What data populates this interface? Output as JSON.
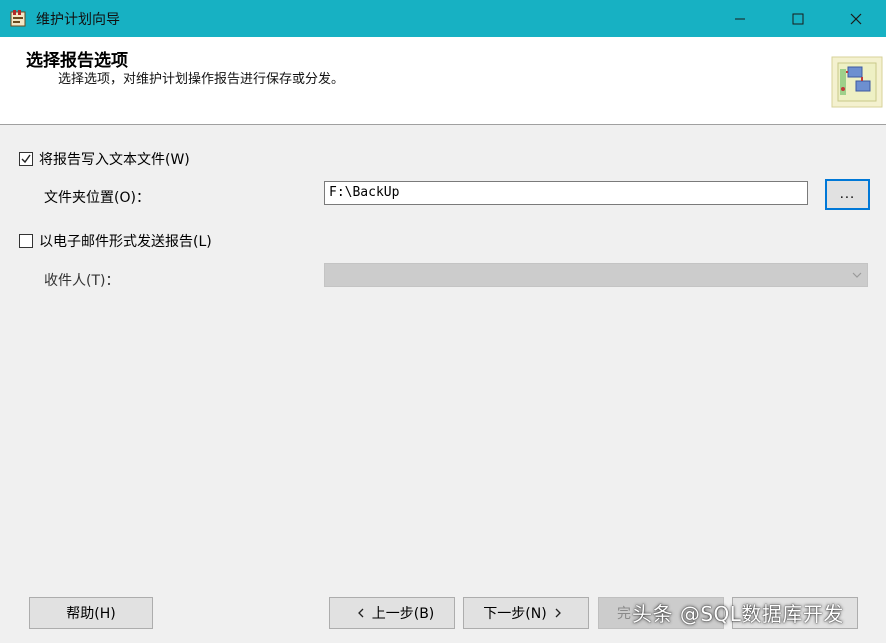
{
  "window": {
    "title": "维护计划向导",
    "accent_color": "#17b1c3"
  },
  "header": {
    "title": "选择报告选项",
    "subtitle": "选择选项，对维护计划操作报告进行保存或分发。"
  },
  "form": {
    "write_to_file": {
      "label": "将报告写入文本文件(W)",
      "checked": true
    },
    "folder_label": "文件夹位置(O)：",
    "folder_value": "F:\\BackUp",
    "browse_label": "...",
    "email": {
      "label": "以电子邮件形式发送报告(L)",
      "checked": false
    },
    "recipient_label": "收件人(T)："
  },
  "footer": {
    "help": "帮助(H)",
    "back": "上一步(B)",
    "next": "下一步(N)",
    "finish": "完",
    "cancel": ""
  },
  "watermark": "头条 @SQL数据库开发",
  "icons": [
    "app-icon",
    "minimize-icon",
    "maximize-icon",
    "close-icon",
    "wizard-art-icon",
    "checkmark-icon",
    "chevron-down-icon",
    "chevron-left-icon",
    "chevron-right-icon"
  ]
}
